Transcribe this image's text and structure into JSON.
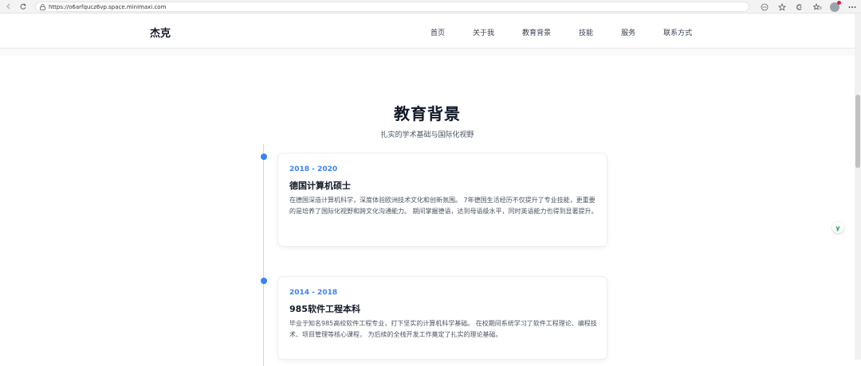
{
  "browser": {
    "url": "https://o6arfqucz6vp.space.minimaxi.com",
    "icons": [
      "back-icon",
      "forward-icon",
      "reload-icon",
      "lock-icon",
      "translate-icon",
      "favorite-icon",
      "extensions-icon",
      "collections-icon",
      "profile-avatar",
      "more-icon"
    ]
  },
  "header": {
    "logo": "杰克",
    "nav": [
      "首页",
      "关于我",
      "教育背景",
      "技能",
      "服务",
      "联系方式"
    ]
  },
  "section": {
    "title": "教育背景",
    "subtitle": "扎实的学术基础与国际化视野"
  },
  "timeline": [
    {
      "period": "2018 - 2020",
      "degree": "德国计算机硕士",
      "description": "在德国深造计算机科学，深度体验欧洲技术文化和创新氛围。 7年德国生活经历不仅提升了专业技能，更重要的是培养了国际化视野和跨文化沟通能力。 期间掌握德语，达到母语级水平，同时英语能力也得到显著提升。"
    },
    {
      "period": "2014 - 2018",
      "degree": "985软件工程本科",
      "description": "毕业于知名985高校软件工程专业，打下坚实的计算机科学基础。 在校期间系统学习了软件工程理论、编程技术、项目管理等核心课程， 为后续的全栈开发工作奠定了扎实的理论基础。"
    }
  ],
  "floating_badge": "y",
  "colors": {
    "accent": "#3b82f6",
    "badge": "#16a34a"
  }
}
